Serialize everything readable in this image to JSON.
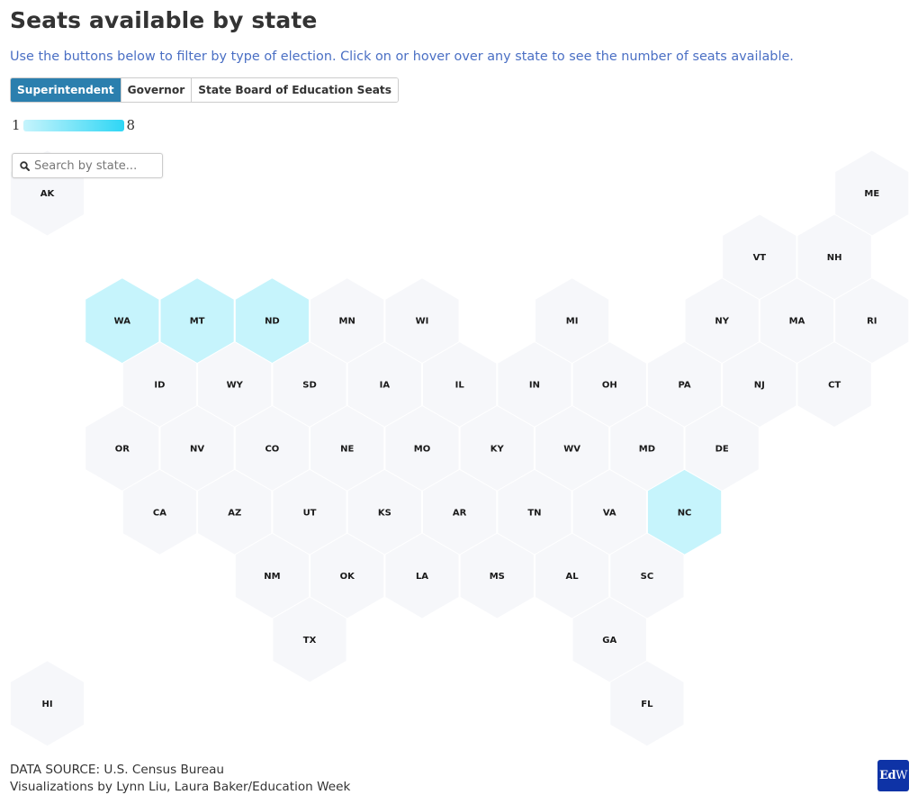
{
  "header": {
    "title": "Seats available by state",
    "subtitle": "Use the buttons below to filter by type of election. Click on or hover over any state to see the number of seats available."
  },
  "filters": {
    "buttons": [
      {
        "label": "Superintendent",
        "active": true
      },
      {
        "label": "Governor",
        "active": false
      },
      {
        "label": "State Board of Education Seats",
        "active": false
      }
    ]
  },
  "legend": {
    "min_label": "1",
    "max_label": "8",
    "min_color": "#c6f4fc",
    "max_color": "#2ed6f5"
  },
  "search": {
    "placeholder": "Search by state...",
    "value": "",
    "icon": "search-icon"
  },
  "colors": {
    "empty": "#f6f7fa",
    "scale_min": "#c6f4fc",
    "scale_max": "#2ed6f5",
    "label": "#1a1a1a",
    "active_button": "#2b7fae",
    "brand": "#0e33a6"
  },
  "chart_data": {
    "type": "heatmap",
    "title": "Seats available by state",
    "subtitle": "Superintendent",
    "legend_range": [
      1,
      8
    ],
    "grid": "hexagonal tile map",
    "states": [
      {
        "abbr": "AK",
        "row": 0,
        "col": 0,
        "value": null
      },
      {
        "abbr": "ME",
        "row": 0,
        "col": 22,
        "value": null
      },
      {
        "abbr": "VT",
        "row": 1,
        "col": 19,
        "value": null
      },
      {
        "abbr": "NH",
        "row": 1,
        "col": 21,
        "value": null
      },
      {
        "abbr": "WA",
        "row": 2,
        "col": 2,
        "value": 1
      },
      {
        "abbr": "MT",
        "row": 2,
        "col": 4,
        "value": 1
      },
      {
        "abbr": "ND",
        "row": 2,
        "col": 6,
        "value": 1
      },
      {
        "abbr": "MN",
        "row": 2,
        "col": 8,
        "value": null
      },
      {
        "abbr": "WI",
        "row": 2,
        "col": 10,
        "value": null
      },
      {
        "abbr": "MI",
        "row": 2,
        "col": 14,
        "value": null
      },
      {
        "abbr": "NY",
        "row": 2,
        "col": 18,
        "value": null
      },
      {
        "abbr": "MA",
        "row": 2,
        "col": 20,
        "value": null
      },
      {
        "abbr": "RI",
        "row": 2,
        "col": 22,
        "value": null
      },
      {
        "abbr": "ID",
        "row": 3,
        "col": 3,
        "value": null
      },
      {
        "abbr": "WY",
        "row": 3,
        "col": 5,
        "value": null
      },
      {
        "abbr": "SD",
        "row": 3,
        "col": 7,
        "value": null
      },
      {
        "abbr": "IA",
        "row": 3,
        "col": 9,
        "value": null
      },
      {
        "abbr": "IL",
        "row": 3,
        "col": 11,
        "value": null
      },
      {
        "abbr": "IN",
        "row": 3,
        "col": 13,
        "value": null
      },
      {
        "abbr": "OH",
        "row": 3,
        "col": 15,
        "value": null
      },
      {
        "abbr": "PA",
        "row": 3,
        "col": 17,
        "value": null
      },
      {
        "abbr": "NJ",
        "row": 3,
        "col": 19,
        "value": null
      },
      {
        "abbr": "CT",
        "row": 3,
        "col": 21,
        "value": null
      },
      {
        "abbr": "OR",
        "row": 4,
        "col": 2,
        "value": null
      },
      {
        "abbr": "NV",
        "row": 4,
        "col": 4,
        "value": null
      },
      {
        "abbr": "CO",
        "row": 4,
        "col": 6,
        "value": null
      },
      {
        "abbr": "NE",
        "row": 4,
        "col": 8,
        "value": null
      },
      {
        "abbr": "MO",
        "row": 4,
        "col": 10,
        "value": null
      },
      {
        "abbr": "KY",
        "row": 4,
        "col": 12,
        "value": null
      },
      {
        "abbr": "WV",
        "row": 4,
        "col": 14,
        "value": null
      },
      {
        "abbr": "MD",
        "row": 4,
        "col": 16,
        "value": null
      },
      {
        "abbr": "DE",
        "row": 4,
        "col": 18,
        "value": null
      },
      {
        "abbr": "CA",
        "row": 5,
        "col": 3,
        "value": null
      },
      {
        "abbr": "AZ",
        "row": 5,
        "col": 5,
        "value": null
      },
      {
        "abbr": "UT",
        "row": 5,
        "col": 7,
        "value": null
      },
      {
        "abbr": "KS",
        "row": 5,
        "col": 9,
        "value": null
      },
      {
        "abbr": "AR",
        "row": 5,
        "col": 11,
        "value": null
      },
      {
        "abbr": "TN",
        "row": 5,
        "col": 13,
        "value": null
      },
      {
        "abbr": "VA",
        "row": 5,
        "col": 15,
        "value": null
      },
      {
        "abbr": "NC",
        "row": 5,
        "col": 17,
        "value": 1
      },
      {
        "abbr": "NM",
        "row": 6,
        "col": 6,
        "value": null
      },
      {
        "abbr": "OK",
        "row": 6,
        "col": 8,
        "value": null
      },
      {
        "abbr": "LA",
        "row": 6,
        "col": 10,
        "value": null
      },
      {
        "abbr": "MS",
        "row": 6,
        "col": 12,
        "value": null
      },
      {
        "abbr": "AL",
        "row": 6,
        "col": 14,
        "value": null
      },
      {
        "abbr": "SC",
        "row": 6,
        "col": 16,
        "value": null
      },
      {
        "abbr": "TX",
        "row": 7,
        "col": 7,
        "value": null
      },
      {
        "abbr": "GA",
        "row": 7,
        "col": 15,
        "value": null
      },
      {
        "abbr": "HI",
        "row": 8,
        "col": 0,
        "value": null
      },
      {
        "abbr": "FL",
        "row": 8,
        "col": 16,
        "value": null
      }
    ]
  },
  "footer": {
    "source": "DATA SOURCE: U.S. Census Bureau",
    "credits": "Visualizations by Lynn Liu, Laura Baker/Education Week"
  },
  "logo": {
    "text_bold": "Ed",
    "text_light": "W"
  }
}
